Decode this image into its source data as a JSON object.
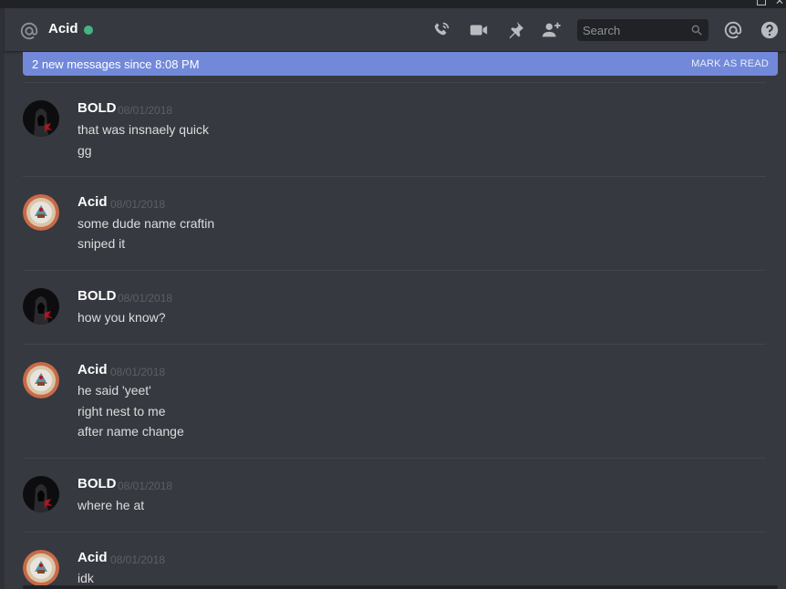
{
  "header": {
    "channel_name": "Acid",
    "search_placeholder": "Search",
    "icons": [
      "at-icon",
      "call-icon",
      "video-icon",
      "pin-icon",
      "add-friend-icon",
      "search-icon",
      "mentions-icon",
      "help-icon"
    ],
    "status_color": "#43b581"
  },
  "banner": {
    "text": "2 new messages since 8:08 PM",
    "action": "MARK AS READ",
    "color": "#7289da"
  },
  "messages": [
    {
      "author": "BOLD",
      "timestamp": "08/01/2018",
      "avatar": "bold-avatar",
      "lines": [
        "that was insnaely quick",
        "gg"
      ]
    },
    {
      "author": "Acid",
      "timestamp": "08/01/2018",
      "avatar": "acid-avatar",
      "lines": [
        "some dude name craftin",
        "sniped it"
      ]
    },
    {
      "author": "BOLD",
      "timestamp": "08/01/2018",
      "avatar": "bold-avatar",
      "lines": [
        "how you know?"
      ]
    },
    {
      "author": "Acid",
      "timestamp": "08/01/2018",
      "avatar": "acid-avatar",
      "lines": [
        "he said 'yeet'",
        "right nest to me",
        "after name change"
      ]
    },
    {
      "author": "BOLD",
      "timestamp": "08/01/2018",
      "avatar": "bold-avatar",
      "lines": [
        "where he at"
      ]
    },
    {
      "author": "Acid",
      "timestamp": "08/01/2018",
      "avatar": "acid-avatar",
      "lines": [
        "idk"
      ]
    }
  ]
}
